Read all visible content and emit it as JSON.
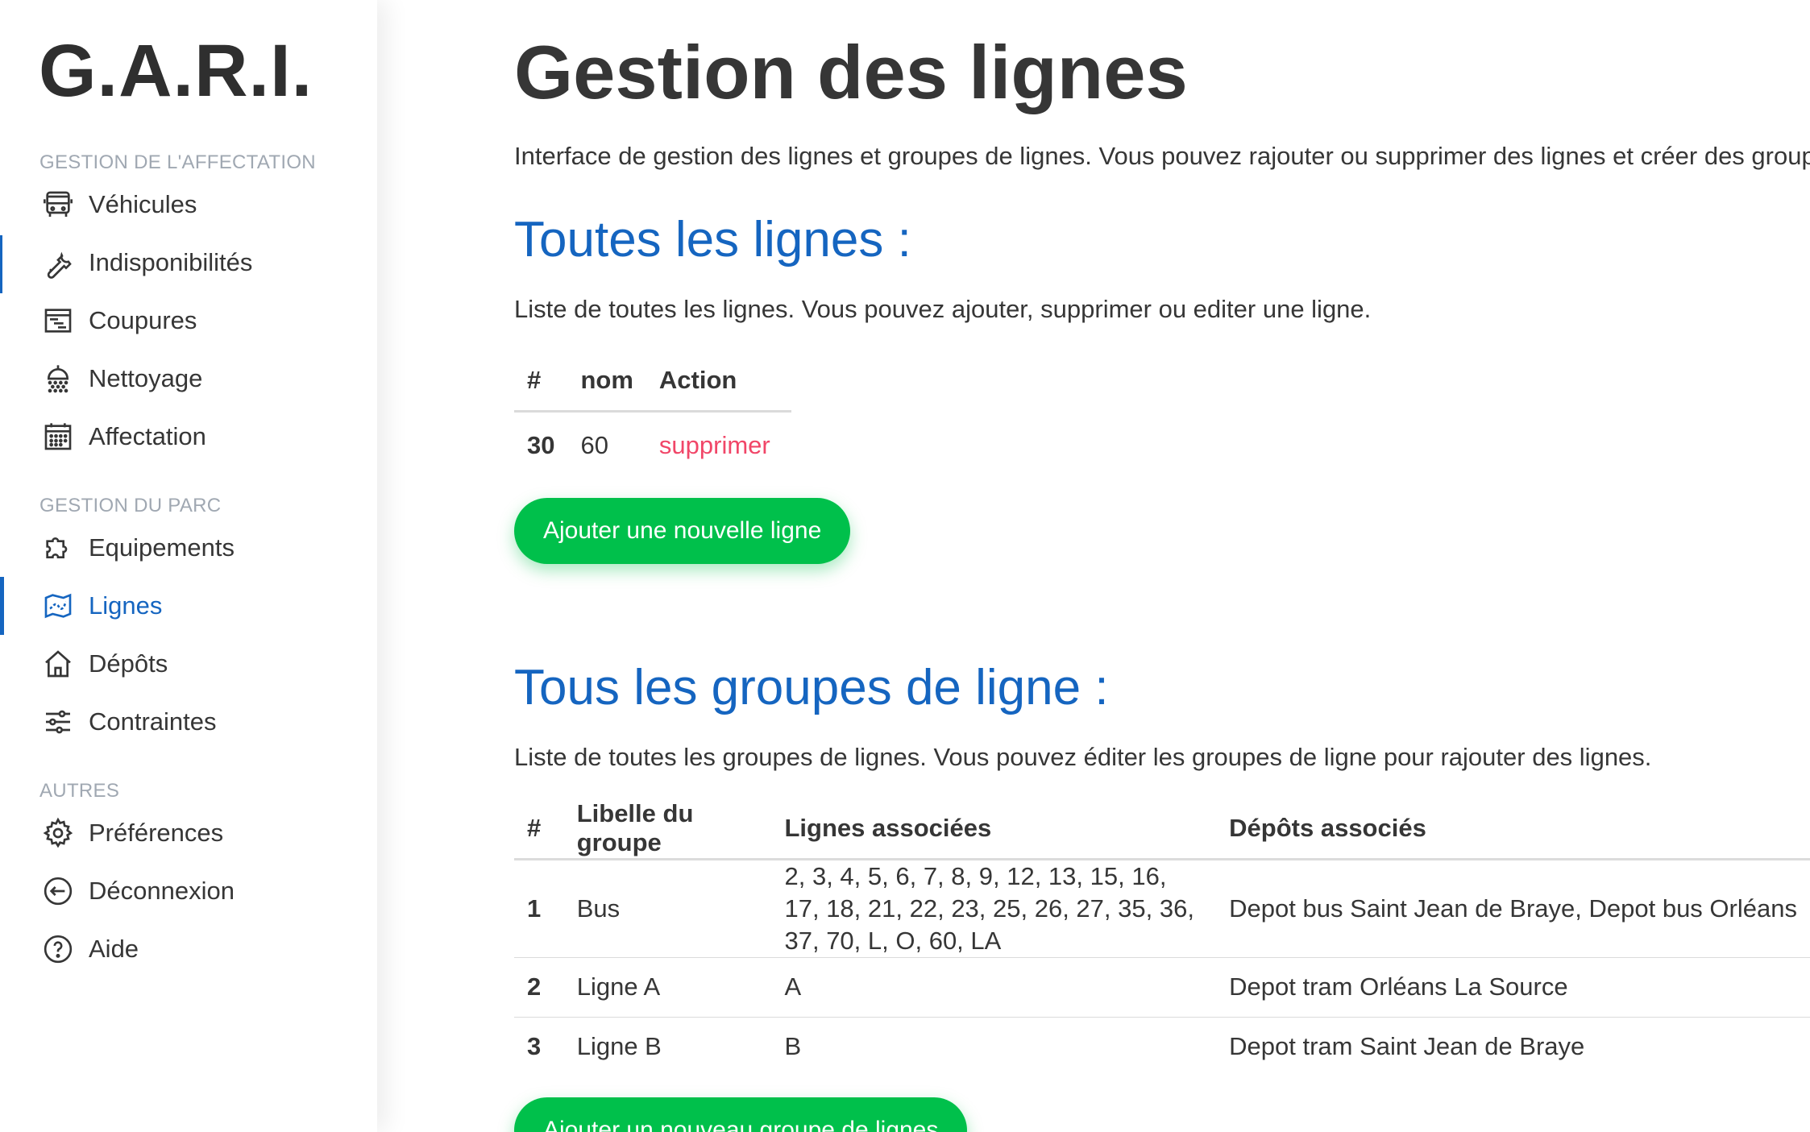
{
  "brand": "G.A.R.I.",
  "sidebar": {
    "sections": [
      {
        "label": "GESTION DE L'AFFECTATION",
        "items": [
          {
            "label": "Véhicules",
            "icon": "bus-icon"
          },
          {
            "label": "Indisponibilités",
            "icon": "wrench-icon"
          },
          {
            "label": "Coupures",
            "icon": "timeline-icon"
          },
          {
            "label": "Nettoyage",
            "icon": "shower-icon"
          },
          {
            "label": "Affectation",
            "icon": "calendar-icon"
          }
        ]
      },
      {
        "label": "GESTION DU PARC",
        "items": [
          {
            "label": "Equipements",
            "icon": "puzzle-icon"
          },
          {
            "label": "Lignes",
            "icon": "map-icon",
            "active": true
          },
          {
            "label": "Dépôts",
            "icon": "home-icon"
          },
          {
            "label": "Contraintes",
            "icon": "sliders-icon"
          }
        ]
      },
      {
        "label": "AUTRES",
        "items": [
          {
            "label": "Préférences",
            "icon": "gear-icon"
          },
          {
            "label": "Déconnexion",
            "icon": "logout-icon"
          },
          {
            "label": "Aide",
            "icon": "help-icon"
          }
        ]
      }
    ]
  },
  "main": {
    "title": "Gestion des lignes",
    "intro": "Interface de gestion des lignes et groupes de lignes. Vous pouvez rajouter ou supprimer des lignes et créer des groupements",
    "lines_section": {
      "title": "Toutes les lignes :",
      "description": "Liste de toutes les lignes. Vous pouvez ajouter, supprimer ou editer une ligne.",
      "columns": [
        "#",
        "nom",
        "Action"
      ],
      "rows": [
        {
          "id": "30",
          "name": "60",
          "action": "supprimer"
        }
      ],
      "add_button": "Ajouter une nouvelle ligne"
    },
    "groups_section": {
      "title": "Tous les groupes de ligne :",
      "description": "Liste de toutes les groupes de lignes. Vous pouvez éditer les groupes de ligne pour rajouter des lignes.",
      "columns": [
        "#",
        "Libelle du groupe",
        "Lignes associées",
        "Dépôts associés"
      ],
      "rows": [
        {
          "id": "1",
          "label": "Bus",
          "lines": "2, 3, 4, 5, 6, 7, 8, 9, 12, 13, 15, 16, 17, 18, 21, 22, 23, 25, 26, 27, 35, 36, 37, 70, L, O, 60, LA",
          "depots": "Depot bus Saint Jean de Braye, Depot bus Orléans"
        },
        {
          "id": "2",
          "label": "Ligne A",
          "lines": "A",
          "depots": "Depot tram Orléans La Source"
        },
        {
          "id": "3",
          "label": "Ligne B",
          "lines": "B",
          "depots": "Depot tram Saint Jean de Braye"
        }
      ],
      "add_button": "Ajouter un nouveau groupe de lignes"
    }
  }
}
